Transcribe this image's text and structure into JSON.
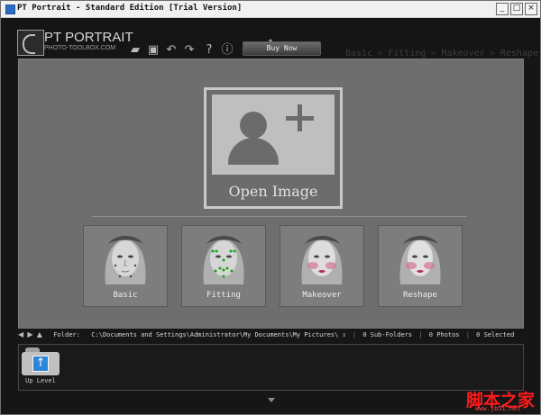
{
  "window": {
    "title": "PT Portrait - Standard Edition [Trial Version]",
    "buttons": [
      "_",
      "□",
      "×"
    ]
  },
  "brand": {
    "name": "PT PORTRAIT",
    "site": "PHOTO-TOOLBOX.COM"
  },
  "toolbar": {
    "icons": [
      "open-folder-icon",
      "save-icon",
      "undo-icon",
      "redo-icon",
      "help-icon",
      "info-icon"
    ],
    "buy_label": "Buy Now",
    "tabs": [
      "Basic",
      "Fitting",
      "Makeover",
      "Reshape"
    ]
  },
  "main": {
    "open_label": "Open Image",
    "features": [
      {
        "label": "Basic"
      },
      {
        "label": "Fitting"
      },
      {
        "label": "Makeover"
      },
      {
        "label": "Reshape"
      }
    ]
  },
  "status": {
    "folder_label": "Folder:",
    "folder_path": "C:\\Documents and Settings\\Administrator\\My Documents\\My Pictures\\",
    "subfolders": "0 Sub-Folders",
    "photos": "0 Photos",
    "selected": "0 Selected"
  },
  "filepane": {
    "up_label": "Up Level"
  },
  "watermark": {
    "text": "脚本之家",
    "site": "www.jb51.net"
  }
}
